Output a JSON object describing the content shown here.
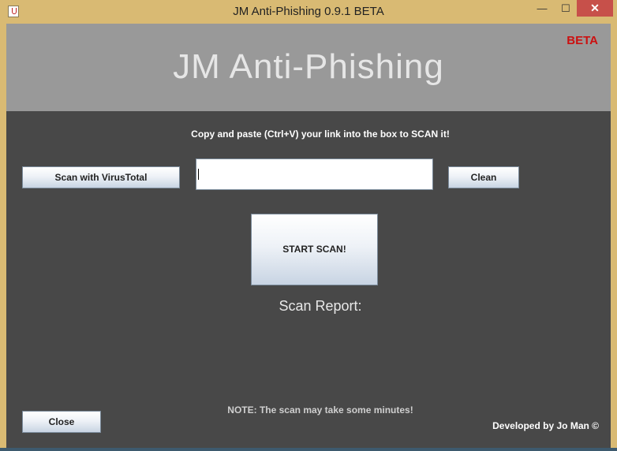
{
  "window": {
    "title": "JM Anti-Phishing 0.9.1 BETA",
    "min_glyph": "—",
    "max_glyph": "☐",
    "close_glyph": "✕"
  },
  "header": {
    "app_name": "JM Anti-Phishing",
    "badge": "BETA"
  },
  "scan": {
    "instruction": "Copy and paste (Ctrl+V) your link into the box to SCAN it!",
    "virustotal_label": "Scan with VirusTotal",
    "clean_label": "Clean",
    "link_value": "",
    "start_label": "START SCAN!",
    "report_label": "Scan Report:"
  },
  "footer": {
    "note": "NOTE: The scan may take some minutes!",
    "close_label": "Close",
    "developer": "Developed by Jo Man ©"
  },
  "colors": {
    "title_bar": "#d9ba73",
    "header_panel": "#999999",
    "body_panel": "#484848",
    "beta_badge": "#cc1010",
    "close_button": "#c7504a"
  },
  "icons": {
    "app": "java-coffee-icon"
  }
}
